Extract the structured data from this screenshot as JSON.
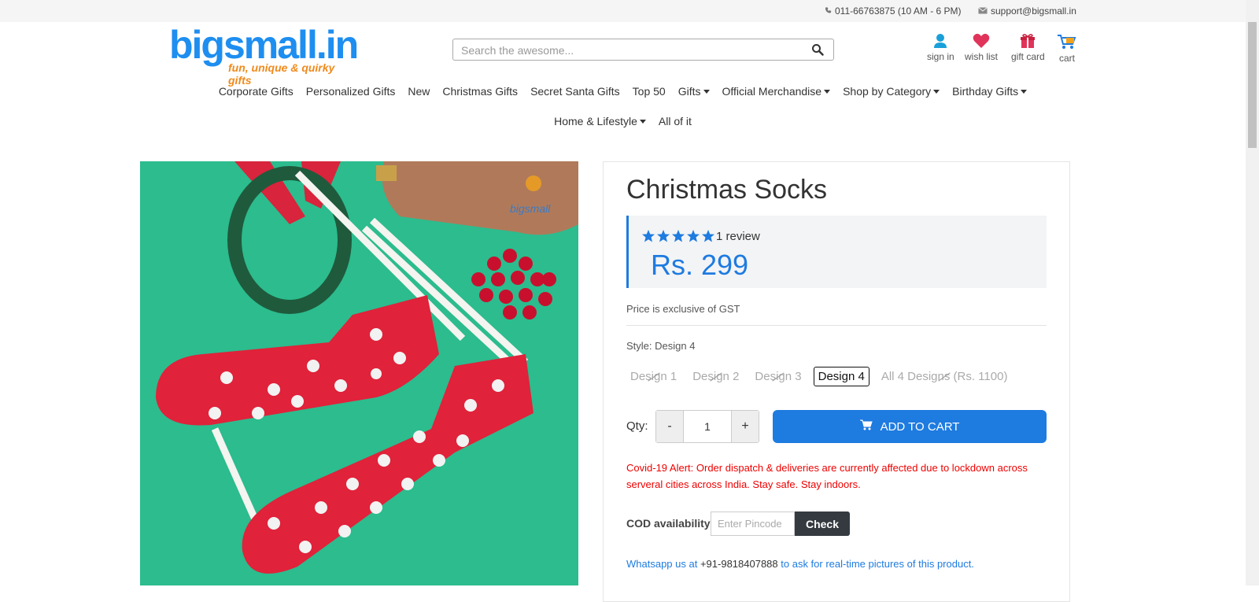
{
  "topbar": {
    "phone": "011-66763875 (10 AM - 6 PM)",
    "email": "support@bigsmall.in"
  },
  "logo": {
    "name": "bigsmall.in",
    "tagline": "fun, unique & quirky gifts"
  },
  "search": {
    "placeholder": "Search the awesome..."
  },
  "header_icons": {
    "signin": "sign in",
    "wishlist": "wish list",
    "giftcard": "gift card",
    "cart": "cart"
  },
  "nav": {
    "row1": [
      {
        "label": "Corporate Gifts"
      },
      {
        "label": "Personalized Gifts"
      },
      {
        "label": "New"
      },
      {
        "label": "Christmas Gifts"
      },
      {
        "label": "Secret Santa Gifts"
      },
      {
        "label": "Top 50"
      },
      {
        "label": "Gifts"
      },
      {
        "label": "Official Merchandise"
      },
      {
        "label": "Shop by Category"
      },
      {
        "label": "Birthday Gifts"
      }
    ],
    "row2": [
      {
        "label": "Home & Lifestyle"
      },
      {
        "label": "All of it"
      }
    ]
  },
  "product": {
    "title": "Christmas Socks",
    "rating": 5,
    "review_text": "1 review",
    "price": "Rs. 299",
    "gst_note": "Price is exclusive of GST",
    "style_label": "Style: Design 4",
    "designs": [
      {
        "label": "Design 1",
        "state": "disabled"
      },
      {
        "label": "Design 2",
        "state": "disabled"
      },
      {
        "label": "Design 3",
        "state": "disabled"
      },
      {
        "label": "Design 4",
        "state": "selected"
      },
      {
        "label": "All 4 Designs (Rs. 1100)",
        "state": "disabled"
      }
    ],
    "qty_label": "Qty:",
    "qty_minus": "-",
    "qty_value": "1",
    "qty_plus": "+",
    "add_to_cart": "ADD TO CART",
    "covid_alert": "Covid-19 Alert: Order dispatch & deliveries are currently affected due to lockdown across serveral cities across India. Stay safe. Stay indoors.",
    "cod_label": "COD availability",
    "pincode_placeholder": "Enter Pincode",
    "check_label": "Check",
    "whatsapp_prefix": "Whatsapp us at",
    "whatsapp_number": "+91-9818407888",
    "whatsapp_suffix": "to ask for real-time pictures of this product."
  },
  "colors": {
    "brand_blue": "#1e7be0",
    "alert_red": "#e00000",
    "photo_bg": "#2cbc8e",
    "sock_red": "#e0223a"
  }
}
